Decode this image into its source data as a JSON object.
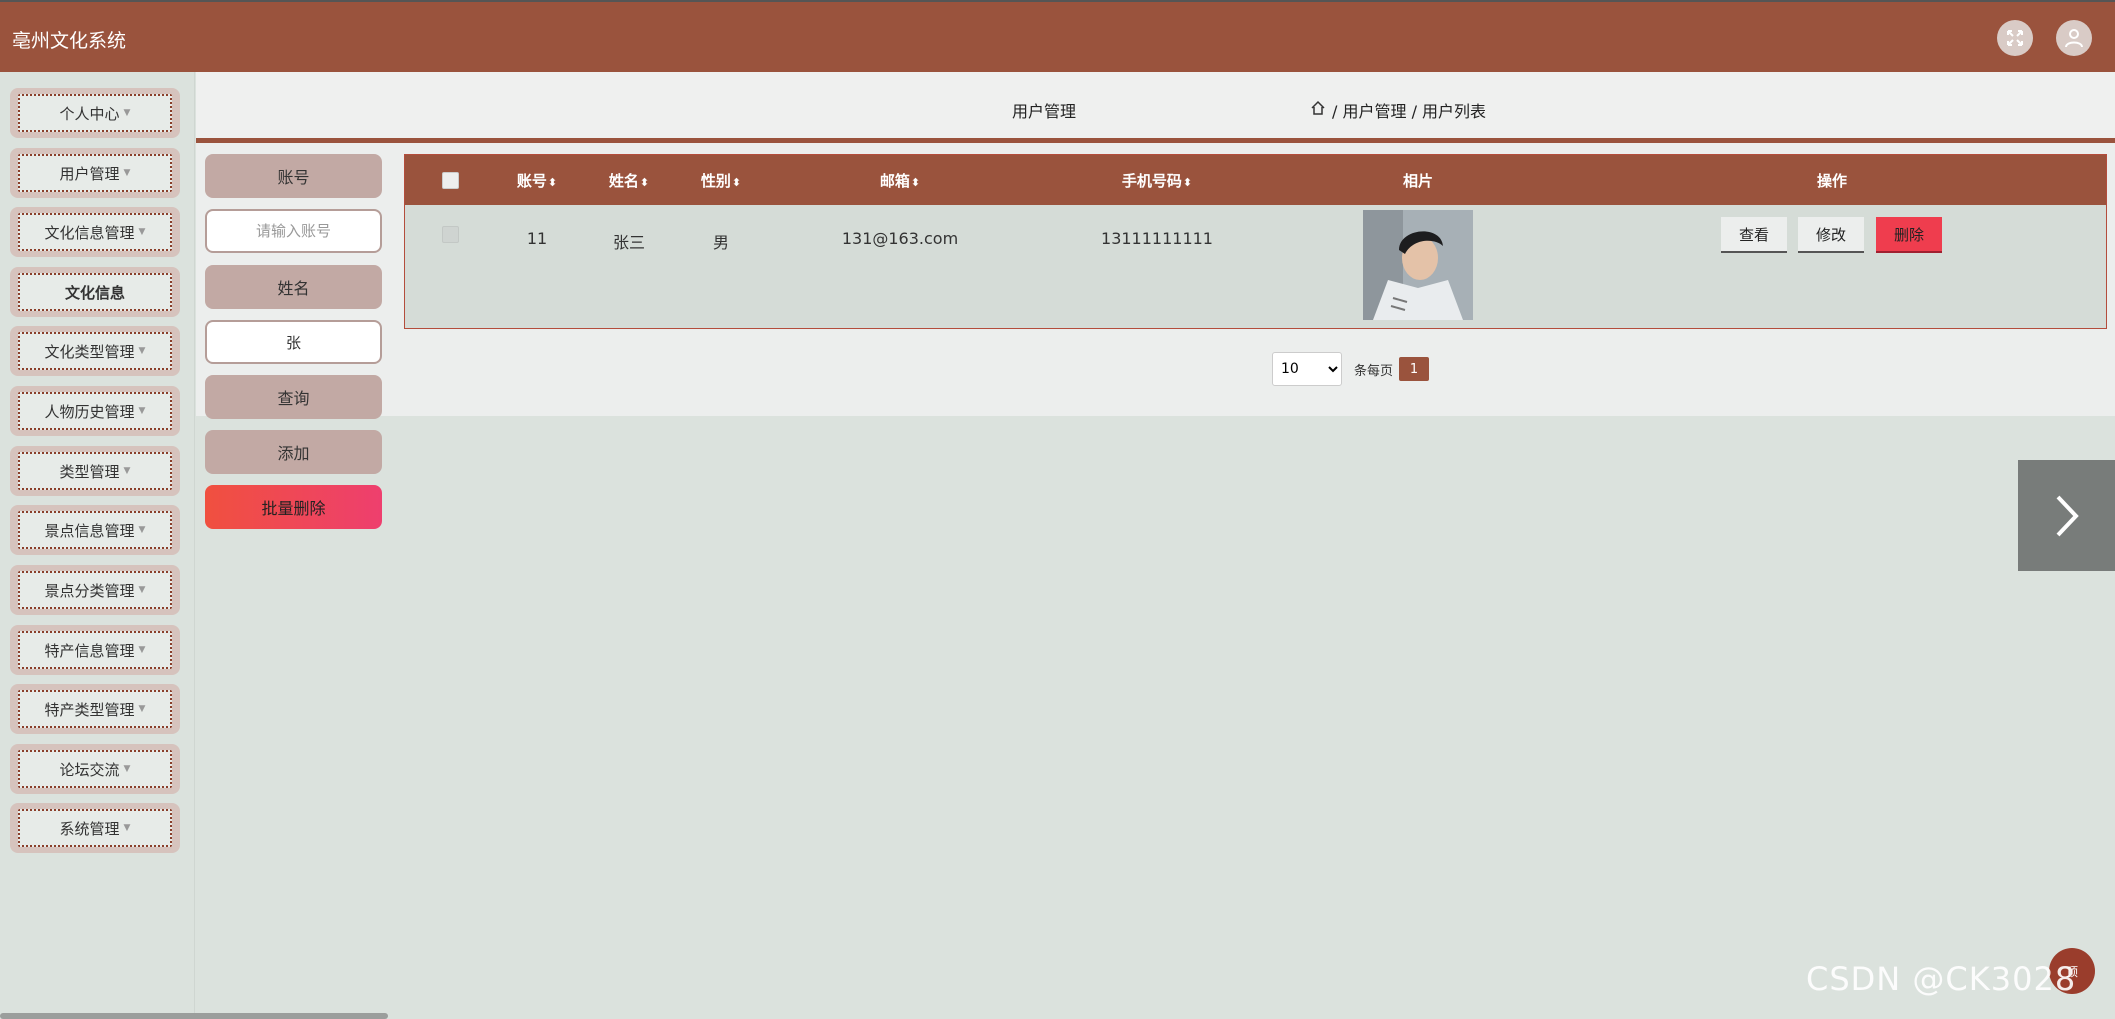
{
  "app": {
    "title": "亳州文化系统"
  },
  "colors": {
    "primary": "#9a533d",
    "danger": "#ef3d4e",
    "background": "#dbe2dd"
  },
  "header": {
    "icons": [
      "fullscreen-icon",
      "user-avatar-icon"
    ]
  },
  "sidebar": {
    "items": [
      {
        "label": "个人中心",
        "caret": true
      },
      {
        "label": "用户管理",
        "caret": true
      },
      {
        "label": "文化信息管理",
        "caret": true
      },
      {
        "label": "文化信息",
        "caret": false
      },
      {
        "label": "文化类型管理",
        "caret": true
      },
      {
        "label": "人物历史管理",
        "caret": true
      },
      {
        "label": "类型管理",
        "caret": true
      },
      {
        "label": "景点信息管理",
        "caret": true
      },
      {
        "label": "景点分类管理",
        "caret": true
      },
      {
        "label": "特产信息管理",
        "caret": true
      },
      {
        "label": "特产类型管理",
        "caret": true
      },
      {
        "label": "论坛交流",
        "caret": true
      },
      {
        "label": "系统管理",
        "caret": true
      }
    ]
  },
  "breadcrumb": {
    "title": "用户管理",
    "path": "/ 用户管理 / 用户列表"
  },
  "search": {
    "account_label": "账号",
    "account_placeholder": "请输入账号",
    "name_label": "姓名",
    "name_value": "张",
    "query_button": "查询",
    "add_button": "添加",
    "batch_delete_button": "批量删除"
  },
  "table": {
    "columns": [
      "账号",
      "姓名",
      "性别",
      "邮箱",
      "手机号码",
      "相片",
      "操作"
    ],
    "rows": [
      {
        "account": "11",
        "name": "张三",
        "gender": "男",
        "email": "131@163.com",
        "phone": "13111111111"
      }
    ],
    "actions": {
      "view": "查看",
      "edit": "修改",
      "delete": "删除"
    }
  },
  "pagination": {
    "page_size": "10",
    "per_page_label": "条每页",
    "current_page": "1"
  },
  "float_button": {
    "label": "顶"
  },
  "watermark": "CSDN @CK3028"
}
